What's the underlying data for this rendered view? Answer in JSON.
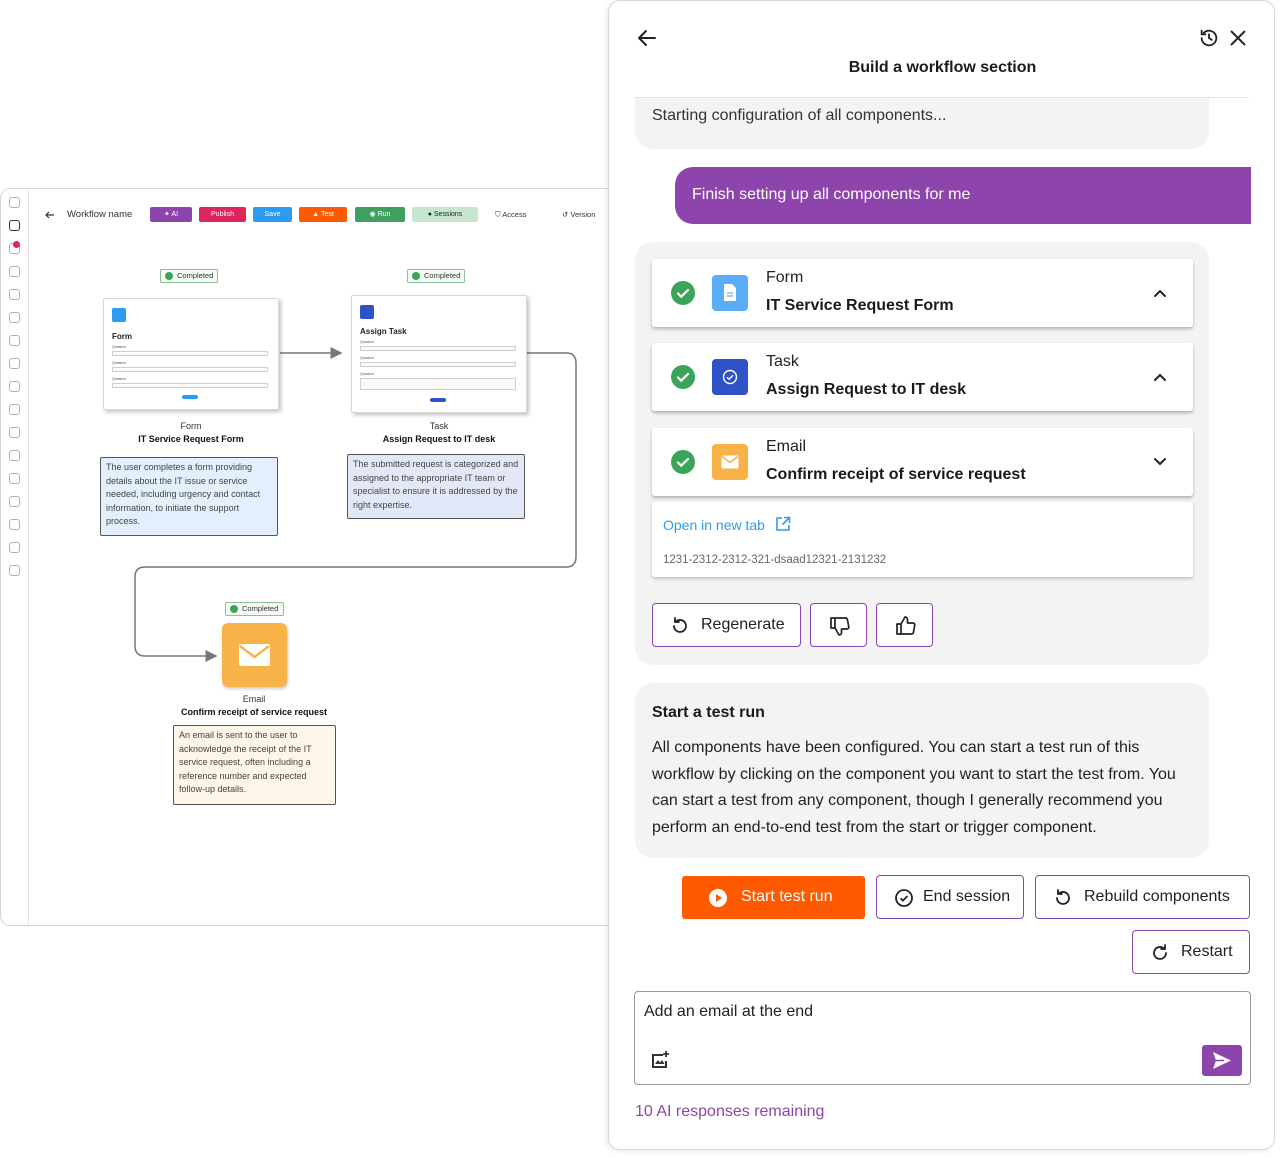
{
  "workflow_app": {
    "toolbar": {
      "back_icon": "arrow-left-icon",
      "title": "Workflow name",
      "ai_label": "AI",
      "publish_label": "Publish",
      "save_label": "Save",
      "test_label": "Test",
      "run_label": "Run",
      "sessions_label": "Sessions",
      "access_label": "Access",
      "version_label": "Version",
      "colors": {
        "ai": "#8e44ad",
        "publish": "#e0245e",
        "save": "#2d9cf0",
        "test": "#ff5a00",
        "run": "#3fa05f",
        "sessions": "#c8e6cf"
      }
    },
    "nodes": [
      {
        "status": "Completed",
        "card_title": "Form",
        "questions": [
          "Question",
          "Question",
          "Question"
        ],
        "type": "Form",
        "name": "IT Service Request Form",
        "description": "The user completes a form providing details about the IT issue or service needed, including urgency and contact information, to initiate the support process."
      },
      {
        "status": "Completed",
        "card_title": "Assign Task",
        "questions": [
          "Question",
          "Question",
          "Question"
        ],
        "type": "Task",
        "name": "Assign Request to IT desk",
        "description": "The submitted request is categorized and assigned to the appropriate IT team or specialist to ensure it is addressed by the right expertise."
      },
      {
        "status": "Completed",
        "type": "Email",
        "name": "Confirm receipt of service request",
        "description": "An email is sent to the user to acknowledge the receipt of the IT service request, often including a reference number and expected follow-up details."
      }
    ]
  },
  "panel": {
    "title": "Build a workflow section",
    "back_icon": "arrow-left-icon",
    "history_icon": "history-icon",
    "close_icon": "close-icon",
    "prev_message": "Starting configuration of all components...",
    "user_message": "Finish setting up all components for me",
    "components": [
      {
        "type": "Form",
        "name": "IT Service Request Form",
        "icon": "document-icon",
        "color": "#5aaef5",
        "expanded": true
      },
      {
        "type": "Task",
        "name": "Assign Request to IT desk",
        "icon": "task-check-icon",
        "color": "#2f52c6",
        "expanded": true
      },
      {
        "type": "Email",
        "name": "Confirm receipt of service request",
        "icon": "mail-icon",
        "color": "#f7b248",
        "expanded": false
      }
    ],
    "open_new_tab": "Open in new tab",
    "session_id": "1231-2312-2312-321-dsaad12321-2131232",
    "regenerate_label": "Regenerate",
    "test_run": {
      "heading": "Start a test run",
      "body": "All components have been configured. You can start a test run of this workflow by clicking on the component you want to start the test from. You can start a test from any component, though I generally recommend you perform an end-to-end test from the start or trigger component."
    },
    "actions": {
      "start_test_run": "Start test run",
      "end_session": "End session",
      "rebuild_components": "Rebuild components",
      "restart": "Restart"
    },
    "input": {
      "value": "Add an email at the end",
      "image_icon": "image-upload-icon",
      "send_icon": "send-icon"
    },
    "remaining": "10 AI responses remaining",
    "colors": {
      "accent": "#8e44ad",
      "start_button": "#ff5a00",
      "link": "#2d9cf0",
      "success": "#3aa55a"
    }
  }
}
